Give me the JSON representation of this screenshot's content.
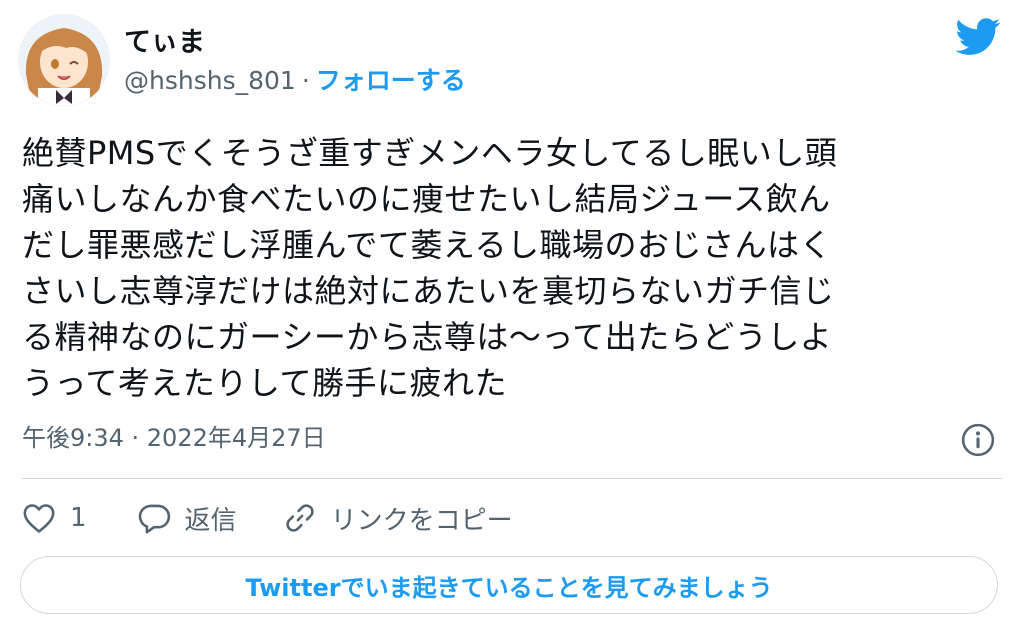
{
  "author": {
    "display_name": "てぃま",
    "handle": "@hshshs_801",
    "separator": "·",
    "follow_label": "フォローする"
  },
  "tweet": {
    "lines": [
      "絶賛PMSでくそうざ重すぎメンヘラ女してるし眠いし頭",
      "痛いしなんか食べたいのに痩せたいし結局ジュース飲ん",
      "だし罪悪感だし浮腫んでて萎えるし職場のおじさんはく",
      "さいし志尊淳だけは絶対にあたいを裏切らないガチ信じ",
      "る精神なのにガーシーから志尊は〜って出たらどうしよ",
      "うって考えたりして勝手に疲れた"
    ],
    "timestamp": "午後9:34 · 2022年4月27日"
  },
  "actions": {
    "like_count": "1",
    "reply_label": "返信",
    "copy_link_label": "リンクをコピー"
  },
  "cta_label": "Twitterでいま起きていることを見てみましょう",
  "colors": {
    "accent": "#1d9bf0",
    "text": "#0f1419",
    "secondary": "#536471",
    "border": "#cfd9de"
  },
  "icons": [
    "twitter-bird-icon",
    "info-icon",
    "heart-icon",
    "reply-bubble-icon",
    "link-icon"
  ]
}
